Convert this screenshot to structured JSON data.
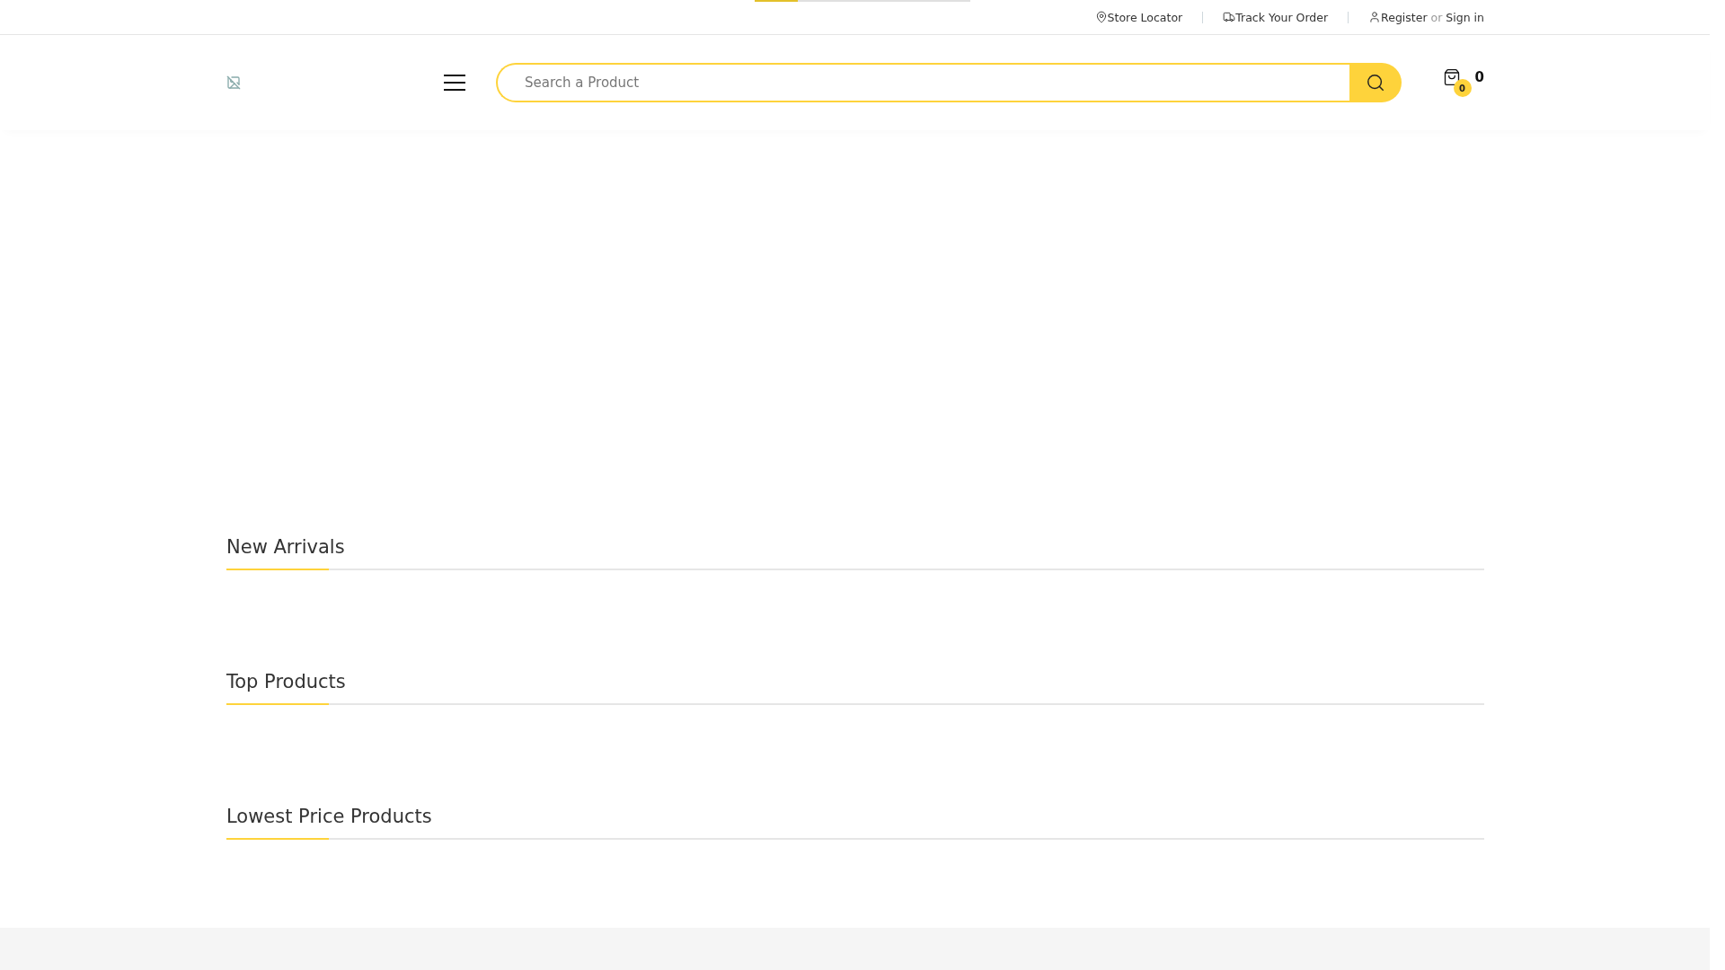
{
  "loading_bar": {
    "level": 0.2
  },
  "top_links": [
    {
      "kind": "store",
      "label": "Store Locator"
    },
    {
      "kind": "track",
      "label": "Track Your Order"
    },
    {
      "kind": "account",
      "label": "Register",
      "joiner": "or",
      "second_label": "Sign in"
    }
  ],
  "search": {
    "placeholder": "Search a Product"
  },
  "cart": {
    "badge": "0",
    "total": "0"
  },
  "sections": [
    {
      "title": "New Arrivals"
    },
    {
      "title": "Top Products"
    },
    {
      "title": "Lowest Price Products"
    }
  ]
}
